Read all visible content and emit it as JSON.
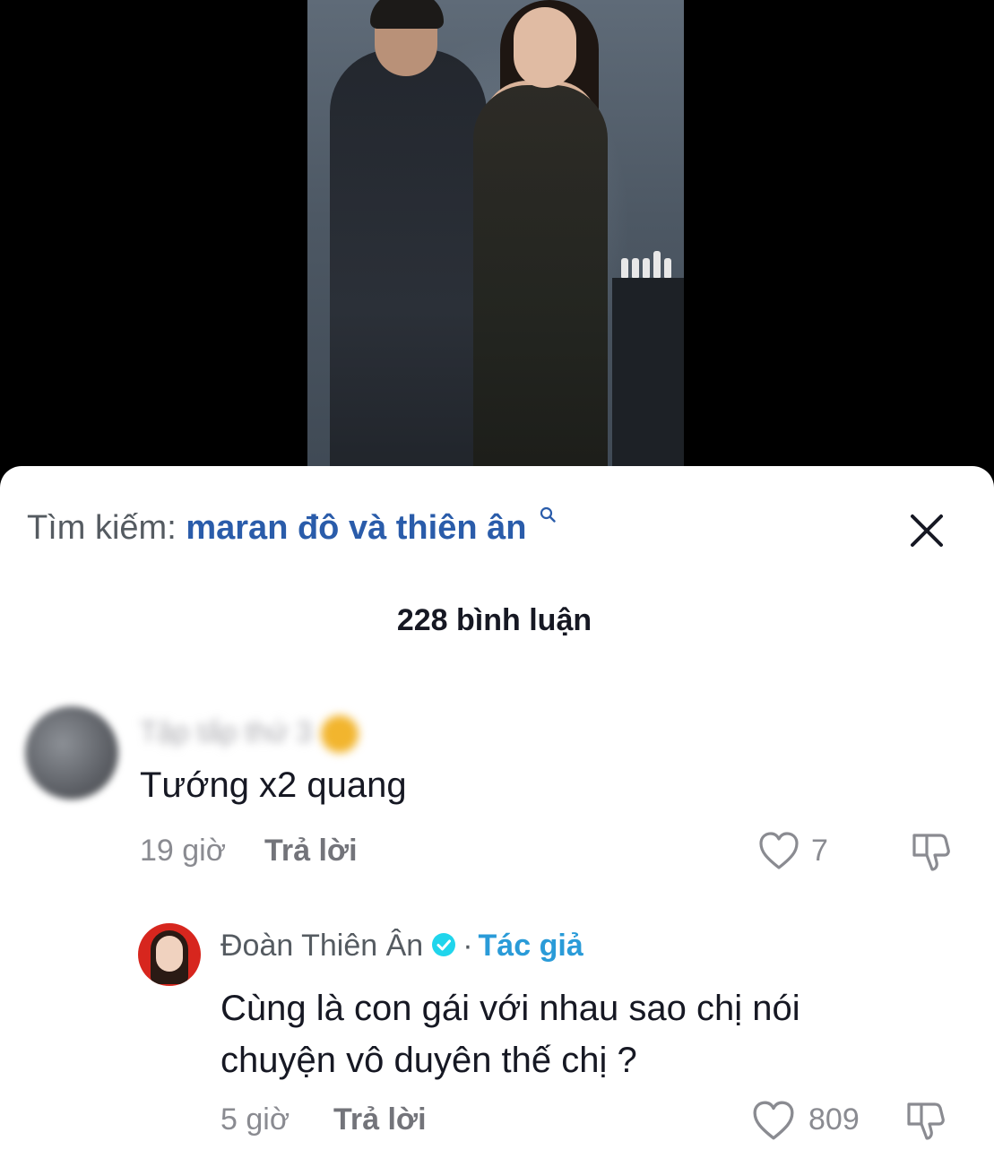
{
  "search": {
    "prefix": "Tìm kiếm:",
    "query": "maran đô và thiên ân"
  },
  "comments_header": {
    "count_label": "228 bình luận"
  },
  "comments": [
    {
      "text": "Tướng x2 quang",
      "time": "19 giờ",
      "reply_label": "Trả lời",
      "likes": "7"
    },
    {
      "username": "Đoàn Thiên Ân",
      "separator": "·",
      "author_tag": "Tác giả",
      "text": "Cùng là con gái với nhau sao chị nói chuyện vô duyên thế chị ?",
      "time": "5 giờ",
      "reply_label": "Trả lời",
      "likes": "809"
    }
  ],
  "colors": {
    "accent": "#2a5caa",
    "verified": "#2a9bd8",
    "sheet_bg": "#ffffff"
  },
  "icons": [
    "search-icon",
    "close-icon",
    "heart-icon",
    "dislike-icon",
    "verified-icon"
  ]
}
